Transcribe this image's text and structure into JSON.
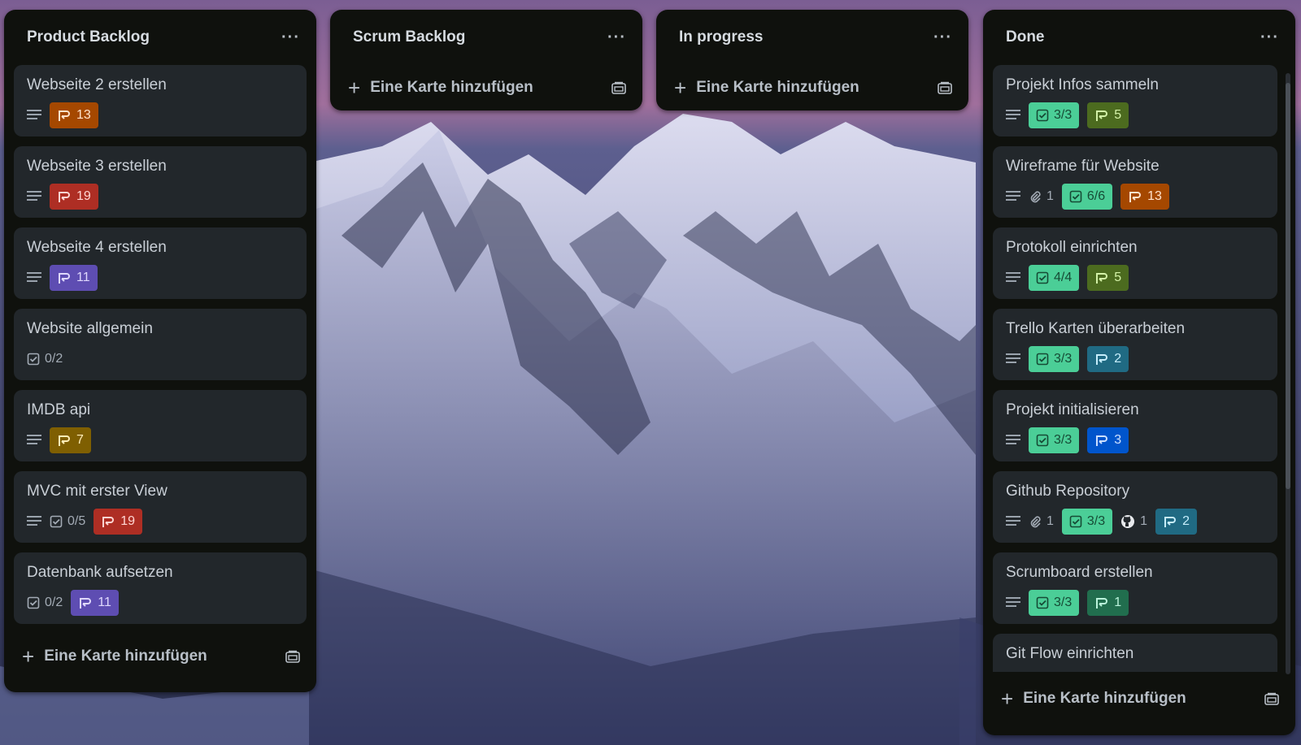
{
  "colors": {
    "list_bg": "#0f110d",
    "card_bg": "#22272b",
    "green_badge": "#4bce97",
    "orange_badge": "#a54800",
    "red_badge": "#ae2e24",
    "purple_badge": "#5e4db2",
    "yellow_badge": "#7f5f01",
    "olive_badge": "#4c6b1f",
    "teal_badge": "#206a83",
    "blue_badge": "#0055cc"
  },
  "lists": [
    {
      "title": "Product Backlog",
      "menu_icon": "more-horizontal-icon",
      "add_label": "Eine Karte hinzufügen",
      "template_icon": "card-template-icon",
      "cards": [
        {
          "title": "Webseite 2 erstellen",
          "story_points": "13",
          "points_color": "orange"
        },
        {
          "title": "Webseite 3 erstellen",
          "story_points": "19",
          "points_color": "red"
        },
        {
          "title": "Webseite 4 erstellen",
          "story_points": "11",
          "points_color": "purple"
        },
        {
          "title": "Website allgemein",
          "checklist": "0/2"
        },
        {
          "title": "IMDB api",
          "story_points": "7",
          "points_color": "yellow"
        },
        {
          "title": "MVC mit erster View",
          "checklist": "0/5",
          "story_points": "19",
          "points_color": "red"
        },
        {
          "title": "Datenbank aufsetzen",
          "checklist": "0/2",
          "story_points": "11",
          "points_color": "purple"
        }
      ]
    },
    {
      "title": "Scrum Backlog",
      "menu_icon": "more-horizontal-icon",
      "add_label": "Eine Karte hinzufügen",
      "template_icon": "card-template-icon",
      "cards": []
    },
    {
      "title": "In progress",
      "menu_icon": "more-horizontal-icon",
      "add_label": "Eine Karte hinzufügen",
      "template_icon": "card-template-icon",
      "cards": []
    },
    {
      "title": "Done",
      "menu_icon": "more-horizontal-icon",
      "add_label": "Eine Karte hinzufügen",
      "template_icon": "card-template-icon",
      "cards": [
        {
          "title": "Projekt Infos sammeln",
          "checklist": "3/3",
          "story_points": "5",
          "points_color": "olive"
        },
        {
          "title": "Wireframe für Website",
          "attachments": "1",
          "checklist": "6/6",
          "story_points": "13",
          "points_color": "orange"
        },
        {
          "title": "Protokoll einrichten",
          "checklist": "4/4",
          "story_points": "5",
          "points_color": "olive"
        },
        {
          "title": "Trello Karten überarbeiten",
          "checklist": "3/3",
          "story_points": "2",
          "points_color": "teal"
        },
        {
          "title": "Projekt initialisieren",
          "checklist": "3/3",
          "story_points": "3",
          "points_color": "blue"
        },
        {
          "title": "Github Repository",
          "attachments": "1",
          "checklist": "3/3",
          "github": "1",
          "story_points": "2",
          "points_color": "teal"
        },
        {
          "title": "Scrumboard erstellen",
          "checklist": "3/3",
          "story_points": "1",
          "points_color": "olive"
        },
        {
          "title": "Git Flow einrichten"
        }
      ]
    }
  ]
}
